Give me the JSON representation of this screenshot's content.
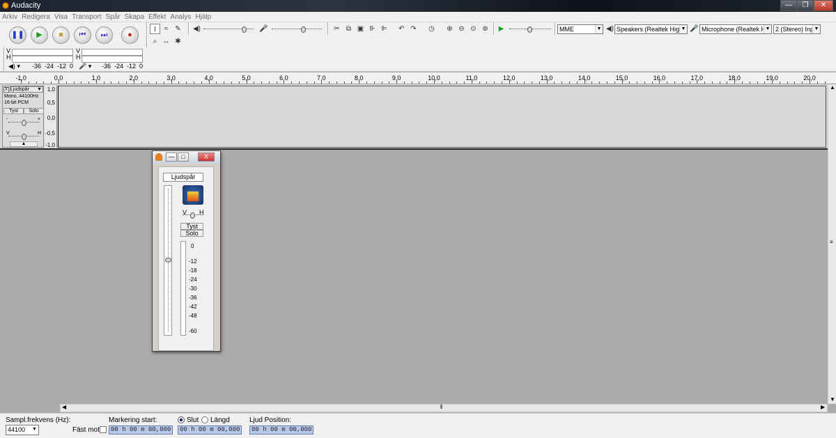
{
  "window": {
    "title": "Audacity"
  },
  "menu": [
    "Arkiv",
    "Redigera",
    "Visa",
    "Transport",
    "Spår",
    "Skapa",
    "Effekt",
    "Analys",
    "Hjälp"
  ],
  "meters": {
    "vh_v": "V",
    "vh_h": "H",
    "ticks": [
      "-36",
      "-24",
      "-12",
      "0"
    ]
  },
  "device": {
    "host": "MME",
    "output": "Speakers (Realtek High D",
    "input": "Microphone (Realtek Hig",
    "channels": "2 (Stereo) Inp"
  },
  "ruler": [
    "-1,0",
    "0,0",
    "1,0",
    "2,0",
    "3,0",
    "4,0",
    "5,0",
    "6,0",
    "7,0",
    "8,0",
    "9,0",
    "10,0",
    "11,0",
    "12,0",
    "13,0",
    "14,0",
    "15,0",
    "16,0",
    "17,0",
    "18,0",
    "19,0",
    "20,0"
  ],
  "track": {
    "close": "X",
    "name": "Ljudspår",
    "info1": "Mono, 44100Hz",
    "info2": "16-bit PCM",
    "mute": "Tyst",
    "solo": "Solo",
    "gain_minus": "-",
    "gain_plus": "+",
    "pan_l": "V",
    "pan_r": "H",
    "scale": [
      "1,0",
      "0,5",
      "0,0",
      "-0,5",
      "-1,0"
    ]
  },
  "mixer": {
    "track_name": "Ljudspår",
    "pan_l": "V",
    "pan_r": "H",
    "mute": "Tyst",
    "solo": "Solo",
    "meter": [
      "0",
      "-12",
      "-18",
      "-24",
      "-30",
      "-36",
      "-42",
      "-48",
      "-60"
    ]
  },
  "status": {
    "rate_label": "Sampl.frekvens (Hz):",
    "rate": "44100",
    "snap_label": "Fäst mot",
    "sel_start_label": "Markering start:",
    "end_label": "Slut",
    "length_label": "Längd",
    "audio_pos_label": "Ljud Position:",
    "sel_start": "00 h 00 m 00,000 s",
    "sel_end": "00 h 00 m 00,000 s",
    "audio_pos": "00 h 00 m 00,000 s"
  }
}
